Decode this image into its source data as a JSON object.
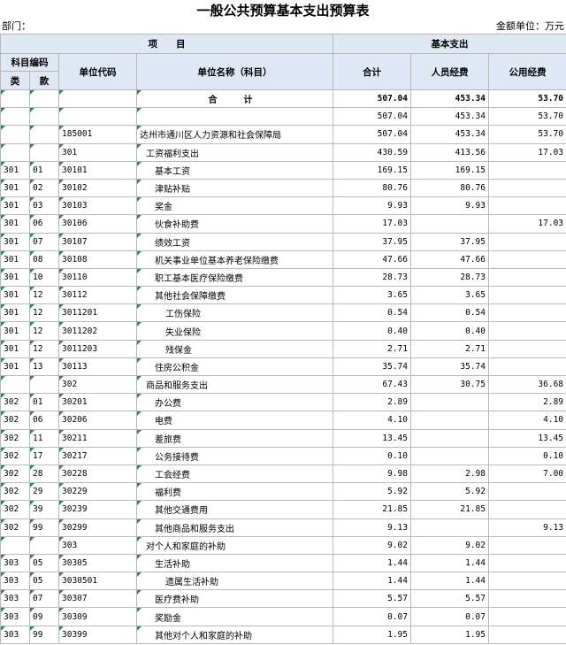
{
  "title": "一般公共预算基本支出预算表",
  "dept_label": "部门：",
  "unit_label": "金额单位：万元",
  "header": {
    "item": "项　　目",
    "basic": "基本支出",
    "subject_code": "科目编码",
    "unit_code": "单位代码",
    "unit_name": "单位名称（科目）",
    "total": "合计",
    "personnel": "人员经费",
    "public": "公用经费",
    "lei": "类",
    "kuan": "款"
  },
  "rows": [
    {
      "lei": "",
      "kuan": "",
      "code": "",
      "name": "合　计",
      "total": "507.04",
      "personnel": "453.34",
      "public": "53.70",
      "type": "total"
    },
    {
      "lei": "",
      "kuan": "",
      "code": "",
      "name": "",
      "total": "507.04",
      "personnel": "453.34",
      "public": "53.70"
    },
    {
      "lei": "",
      "kuan": "",
      "code": "185001",
      "name": "达州市通川区人力资源和社会保障局",
      "total": "507.04",
      "personnel": "453.34",
      "public": "53.70",
      "indent": 0
    },
    {
      "lei": "",
      "kuan": "",
      "code": "301",
      "name": "工资福利支出",
      "total": "430.59",
      "personnel": "413.56",
      "public": "17.03",
      "indent": 1
    },
    {
      "lei": "301",
      "kuan": "01",
      "code": "30101",
      "name": "基本工资",
      "total": "169.15",
      "personnel": "169.15",
      "public": "",
      "indent": 2
    },
    {
      "lei": "301",
      "kuan": "02",
      "code": "30102",
      "name": "津贴补贴",
      "total": "80.76",
      "personnel": "80.76",
      "public": "",
      "indent": 2
    },
    {
      "lei": "301",
      "kuan": "03",
      "code": "30103",
      "name": "奖金",
      "total": "9.93",
      "personnel": "9.93",
      "public": "",
      "indent": 2
    },
    {
      "lei": "301",
      "kuan": "06",
      "code": "30106",
      "name": "伙食补助费",
      "total": "17.03",
      "personnel": "",
      "public": "17.03",
      "indent": 2
    },
    {
      "lei": "301",
      "kuan": "07",
      "code": "30107",
      "name": "绩效工资",
      "total": "37.95",
      "personnel": "37.95",
      "public": "",
      "indent": 2
    },
    {
      "lei": "301",
      "kuan": "08",
      "code": "30108",
      "name": "机关事业单位基本养老保险缴费",
      "total": "47.66",
      "personnel": "47.66",
      "public": "",
      "indent": 2
    },
    {
      "lei": "301",
      "kuan": "10",
      "code": "30110",
      "name": "职工基本医疗保险缴费",
      "total": "28.73",
      "personnel": "28.73",
      "public": "",
      "indent": 2
    },
    {
      "lei": "301",
      "kuan": "12",
      "code": "30112",
      "name": "其他社会保障缴费",
      "total": "3.65",
      "personnel": "3.65",
      "public": "",
      "indent": 2
    },
    {
      "lei": "301",
      "kuan": "12",
      "code": "3011201",
      "name": "工伤保险",
      "total": "0.54",
      "personnel": "0.54",
      "public": "",
      "indent": 3
    },
    {
      "lei": "301",
      "kuan": "12",
      "code": "3011202",
      "name": "失业保险",
      "total": "0.40",
      "personnel": "0.40",
      "public": "",
      "indent": 3
    },
    {
      "lei": "301",
      "kuan": "12",
      "code": "3011203",
      "name": "残保金",
      "total": "2.71",
      "personnel": "2.71",
      "public": "",
      "indent": 3
    },
    {
      "lei": "301",
      "kuan": "13",
      "code": "30113",
      "name": "住房公积金",
      "total": "35.74",
      "personnel": "35.74",
      "public": "",
      "indent": 2
    },
    {
      "lei": "",
      "kuan": "",
      "code": "302",
      "name": "商品和服务支出",
      "total": "67.43",
      "personnel": "30.75",
      "public": "36.68",
      "indent": 1
    },
    {
      "lei": "302",
      "kuan": "01",
      "code": "30201",
      "name": "办公费",
      "total": "2.89",
      "personnel": "",
      "public": "2.89",
      "indent": 2
    },
    {
      "lei": "302",
      "kuan": "06",
      "code": "30206",
      "name": "电费",
      "total": "4.10",
      "personnel": "",
      "public": "4.10",
      "indent": 2
    },
    {
      "lei": "302",
      "kuan": "11",
      "code": "30211",
      "name": "差旅费",
      "total": "13.45",
      "personnel": "",
      "public": "13.45",
      "indent": 2
    },
    {
      "lei": "302",
      "kuan": "17",
      "code": "30217",
      "name": "公务接待费",
      "total": "0.10",
      "personnel": "",
      "public": "0.10",
      "indent": 2
    },
    {
      "lei": "302",
      "kuan": "28",
      "code": "30228",
      "name": "工会经费",
      "total": "9.98",
      "personnel": "2.98",
      "public": "7.00",
      "indent": 2
    },
    {
      "lei": "302",
      "kuan": "29",
      "code": "30229",
      "name": "福利费",
      "total": "5.92",
      "personnel": "5.92",
      "public": "",
      "indent": 2
    },
    {
      "lei": "302",
      "kuan": "39",
      "code": "30239",
      "name": "其他交通费用",
      "total": "21.85",
      "personnel": "21.85",
      "public": "",
      "indent": 2
    },
    {
      "lei": "302",
      "kuan": "99",
      "code": "30299",
      "name": "其他商品和服务支出",
      "total": "9.13",
      "personnel": "",
      "public": "9.13",
      "indent": 2
    },
    {
      "lei": "",
      "kuan": "",
      "code": "303",
      "name": "对个人和家庭的补助",
      "total": "9.02",
      "personnel": "9.02",
      "public": "",
      "indent": 1
    },
    {
      "lei": "303",
      "kuan": "05",
      "code": "30305",
      "name": "生活补助",
      "total": "1.44",
      "personnel": "1.44",
      "public": "",
      "indent": 2
    },
    {
      "lei": "303",
      "kuan": "05",
      "code": "3030501",
      "name": "遗属生活补助",
      "total": "1.44",
      "personnel": "1.44",
      "public": "",
      "indent": 3
    },
    {
      "lei": "303",
      "kuan": "07",
      "code": "30307",
      "name": "医疗费补助",
      "total": "5.57",
      "personnel": "5.57",
      "public": "",
      "indent": 2
    },
    {
      "lei": "303",
      "kuan": "09",
      "code": "30309",
      "name": "奖励金",
      "total": "0.07",
      "personnel": "0.07",
      "public": "",
      "indent": 2
    },
    {
      "lei": "303",
      "kuan": "99",
      "code": "30399",
      "name": "其他对个人和家庭的补助",
      "total": "1.95",
      "personnel": "1.95",
      "public": "",
      "indent": 2
    }
  ]
}
